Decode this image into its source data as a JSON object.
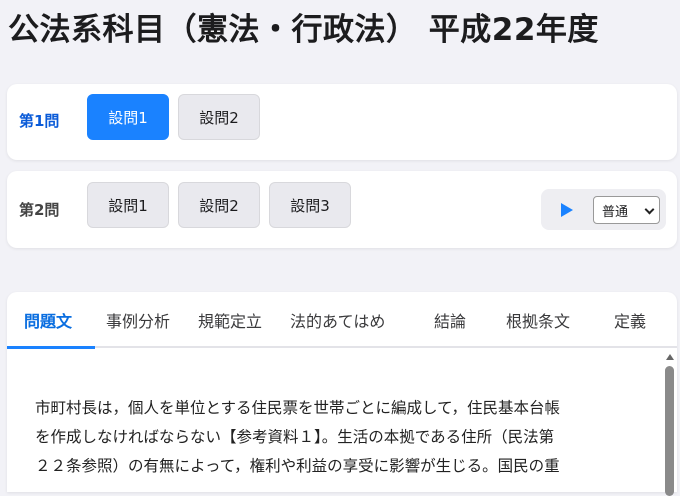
{
  "title": "公法系科目（憲法・行政法） 平成22年度",
  "question1": {
    "label": "第1問",
    "buttons": [
      "設問1",
      "設問2"
    ],
    "active_index": 0
  },
  "question2": {
    "label": "第2問",
    "buttons": [
      "設問1",
      "設問2",
      "設問3"
    ],
    "speed": {
      "selected": "普通"
    }
  },
  "tabs": {
    "items": [
      "問題文",
      "事例分析",
      "規範定立",
      "法的あてはめ",
      "結論",
      "根拠条文",
      "定義"
    ],
    "active_index": 0
  },
  "content": {
    "lines": [
      "市町村長は，個人を単位とする住民票を世帯ごとに編成して，住民基本台帳",
      "を作成しなければならない【参考資料１】。生活の本拠である住所（民法第",
      "２２条参照）の有無によって，権利や利益の享受に影響が生じる。国民の重"
    ]
  },
  "colors": {
    "accent": "#1a82ff",
    "active_label": "#0a5bd8",
    "background": "#f2f2f7"
  },
  "icons": {
    "play": "play-icon",
    "dropdown": "chevron-down-icon"
  }
}
